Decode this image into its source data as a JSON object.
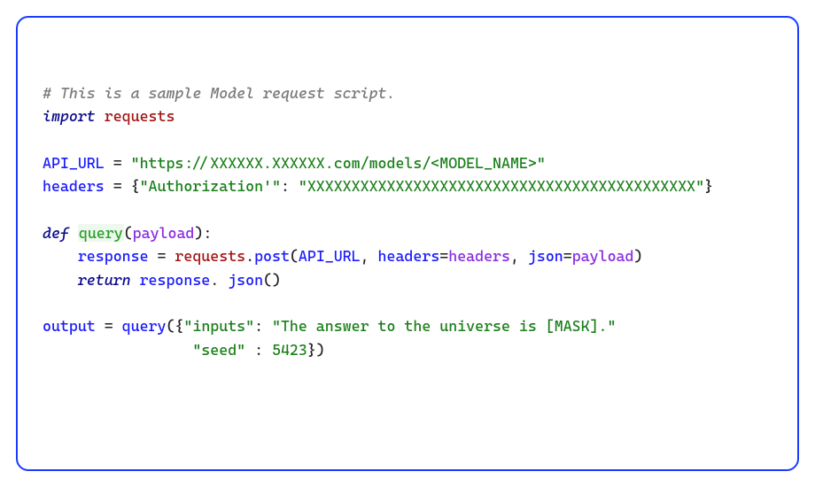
{
  "code": {
    "comment": "# This is a sample Model request script.",
    "import_kw": "import",
    "import_mod": "requests",
    "api_url_var": "API_URL",
    "eq": " = ",
    "api_url_str": "\"https://XXXXXX.XXXXXX.com/models/<MODEL_NAME>\"",
    "headers_var": "headers",
    "headers_open": " = {",
    "headers_key": "\"Authorization'\"",
    "headers_colon": ": ",
    "headers_val": "\"XXXXXXXXXXXXXXXXXXXXXXXXXXXXXXXXXXXXXXXXXXXX\"",
    "headers_close": "}",
    "def_kw": "def",
    "def_sp": " ",
    "fn_name": "query",
    "fn_open": "(",
    "fn_param": "payload",
    "fn_close": "):",
    "indent": "    ",
    "resp_var": "response",
    "resp_eq": " = ",
    "requests_obj": "requests",
    "dot": ".",
    "post_fn": "post",
    "post_open": "(",
    "arg_apiurl": "API_URL",
    "comma": ", ",
    "kw_headers": "headers",
    "kw_eq": "=",
    "arg_headers": "headers",
    "kw_json": "json",
    "arg_payload": "payload",
    "post_close": ")",
    "return_kw": "return",
    "return_sp": " ",
    "resp_obj": "response",
    "json_call": " json",
    "json_parens": "()",
    "output_var": "output",
    "output_eq": " = ",
    "query_call": "query",
    "query_open": "({",
    "inputs_key": "\"inputs\"",
    "inputs_colon": ": ",
    "inputs_val": "\"The answer to the universe is [MASK].\"",
    "line2_pad": "                 ",
    "seed_key": "\"seed\"",
    "seed_colon": " : ",
    "seed_val": "5423",
    "query_close": "})"
  }
}
